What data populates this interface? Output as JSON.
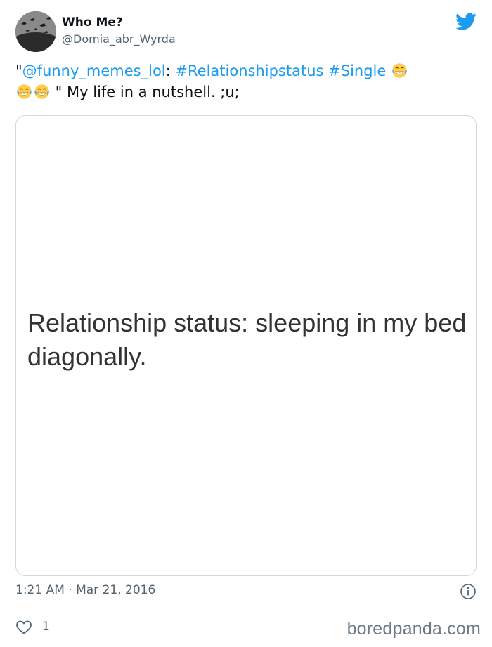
{
  "author": {
    "display_name": "Who Me?",
    "handle": "@Domia_abr_Wyrda",
    "avatar_icon": "avatar-photo"
  },
  "platform_icon": "twitter-bird-icon",
  "tweet": {
    "open_quote": "\"",
    "mention": "@funny_memes_lol",
    "colon": ": ",
    "hashtag_1": "#Relationshipstatus",
    "hashtag_2": "#Single",
    "emoji_name": "face-with-tears-of-joy",
    "tail": " \" My life in a nutshell. ;u;"
  },
  "media": {
    "text": "Relationship status: sleeping in my bed diagonally."
  },
  "meta": {
    "timestamp": "1:21 AM · Mar 21, 2016",
    "info_icon": "info-icon"
  },
  "engagement": {
    "like_icon": "heart-icon",
    "likes": "1"
  },
  "watermark": "boredpanda.com",
  "colors": {
    "link": "#1d9bf0",
    "secondary_text": "#536471",
    "border": "#cfd9de"
  }
}
